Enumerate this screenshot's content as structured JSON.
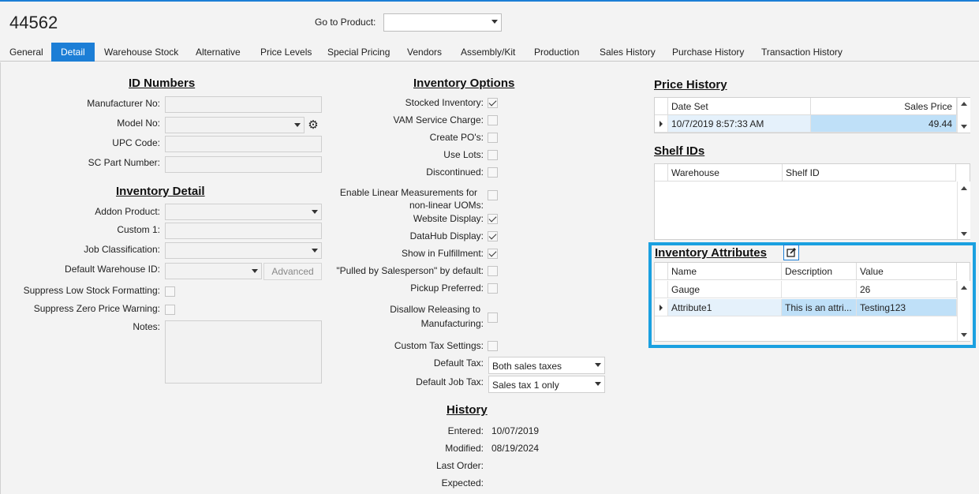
{
  "header": {
    "product_id": "44562",
    "goto_label": "Go to Product:",
    "goto_value": ""
  },
  "tabs": [
    "General",
    "Detail",
    "Warehouse Stock",
    "Alternative",
    "Price Levels",
    "Special Pricing",
    "Vendors",
    "Assembly/Kit",
    "Production",
    "Sales History",
    "Purchase History",
    "Transaction History"
  ],
  "active_tab": "Detail",
  "id_numbers": {
    "title": "ID Numbers",
    "manufacturer_no_label": "Manufacturer No:",
    "manufacturer_no": "",
    "model_no_label": "Model No:",
    "model_no": "",
    "upc_label": "UPC Code:",
    "upc": "",
    "sc_part_label": "SC Part Number:",
    "sc_part": ""
  },
  "inventory_detail": {
    "title": "Inventory Detail",
    "addon_label": "Addon Product:",
    "custom1_label": "Custom 1:",
    "job_class_label": "Job Classification:",
    "default_wh_label": "Default Warehouse ID:",
    "advanced_label": "Advanced",
    "suppress_low_label": "Suppress Low Stock Formatting:",
    "suppress_zero_label": "Suppress Zero Price Warning:",
    "notes_label": "Notes:"
  },
  "inventory_options": {
    "title": "Inventory Options",
    "stocked": {
      "label": "Stocked Inventory:",
      "checked": true
    },
    "vam": {
      "label": "VAM Service Charge:",
      "checked": false
    },
    "create_po": {
      "label": "Create PO's:",
      "checked": false
    },
    "use_lots": {
      "label": "Use Lots:",
      "checked": false
    },
    "discontinued": {
      "label": "Discontinued:",
      "checked": false
    },
    "linear_line1": "Enable Linear Measurements for",
    "linear_line2": "non-linear UOMs:",
    "website": {
      "label": "Website Display:",
      "checked": true
    },
    "datahub": {
      "label": "DataHub Display:",
      "checked": true
    },
    "fulfillment": {
      "label": "Show in Fulfillment:",
      "checked": true
    },
    "pulled": {
      "label": "\"Pulled by Salesperson\" by default:",
      "checked": false
    },
    "pickup": {
      "label": "Pickup Preferred:",
      "checked": false
    },
    "disallow_line1": "Disallow Releasing to",
    "disallow_line2": "Manufacturing:",
    "custom_tax": {
      "label": "Custom Tax Settings:",
      "checked": false
    },
    "default_tax_label": "Default Tax:",
    "default_tax": "Both sales taxes",
    "default_job_tax_label": "Default Job Tax:",
    "default_job_tax": "Sales tax 1 only"
  },
  "history": {
    "title": "History",
    "entered_label": "Entered:",
    "entered": "10/07/2019",
    "modified_label": "Modified:",
    "modified": "08/19/2024",
    "last_order_label": "Last Order:",
    "last_order": "",
    "expected_label": "Expected:",
    "expected": ""
  },
  "price_history": {
    "title": "Price History",
    "col_date": "Date Set",
    "col_price": "Sales Price",
    "rows": [
      {
        "date": "10/7/2019 8:57:33 AM",
        "price": "49.44"
      }
    ]
  },
  "shelf_ids": {
    "title": "Shelf IDs",
    "col_warehouse": "Warehouse",
    "col_shelf": "Shelf ID"
  },
  "inventory_attributes": {
    "title": "Inventory Attributes",
    "col_name": "Name",
    "col_desc": "Description",
    "col_value": "Value",
    "rows": [
      {
        "name": "Gauge",
        "desc": "",
        "value": "26"
      },
      {
        "name": "Attribute1",
        "desc": "This is an attri...",
        "value": "Testing123"
      }
    ]
  },
  "colors": {
    "accent": "#1c7ed6",
    "highlight_border": "#1aa0e0",
    "selected_cell": "#bfe0f8"
  }
}
